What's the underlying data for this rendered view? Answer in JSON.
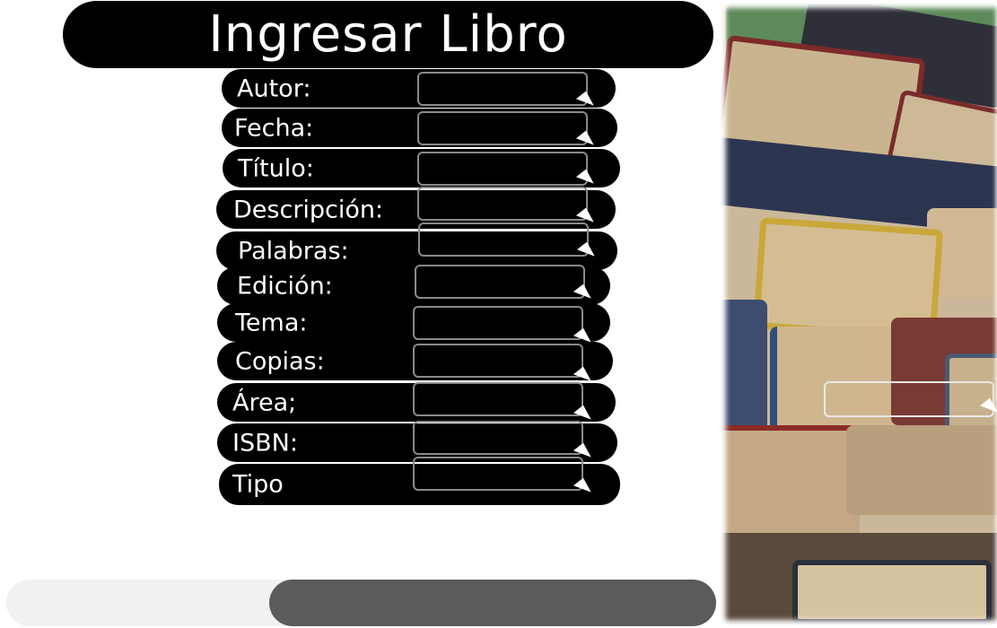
{
  "title": "Ingresar Libro",
  "fields": [
    {
      "label": "Autor:"
    },
    {
      "label": "Fecha:"
    },
    {
      "label": "Título:"
    },
    {
      "label": "Descripción:"
    },
    {
      "label": "Palabras:"
    },
    {
      "label": "Edición:"
    },
    {
      "label": "Tema:"
    },
    {
      "label": "Copias:"
    },
    {
      "label": "Área;"
    },
    {
      "label": "ISBN:"
    },
    {
      "label": "Tipo"
    }
  ],
  "icons": {
    "field_cursor": "mouse-cursor-icon",
    "background": "stacked-books-image"
  },
  "colors": {
    "row_background": "#000000",
    "field_border": "#8a8a8a",
    "submit_button": "#5b5b5b",
    "track": "#f1f1f1"
  }
}
